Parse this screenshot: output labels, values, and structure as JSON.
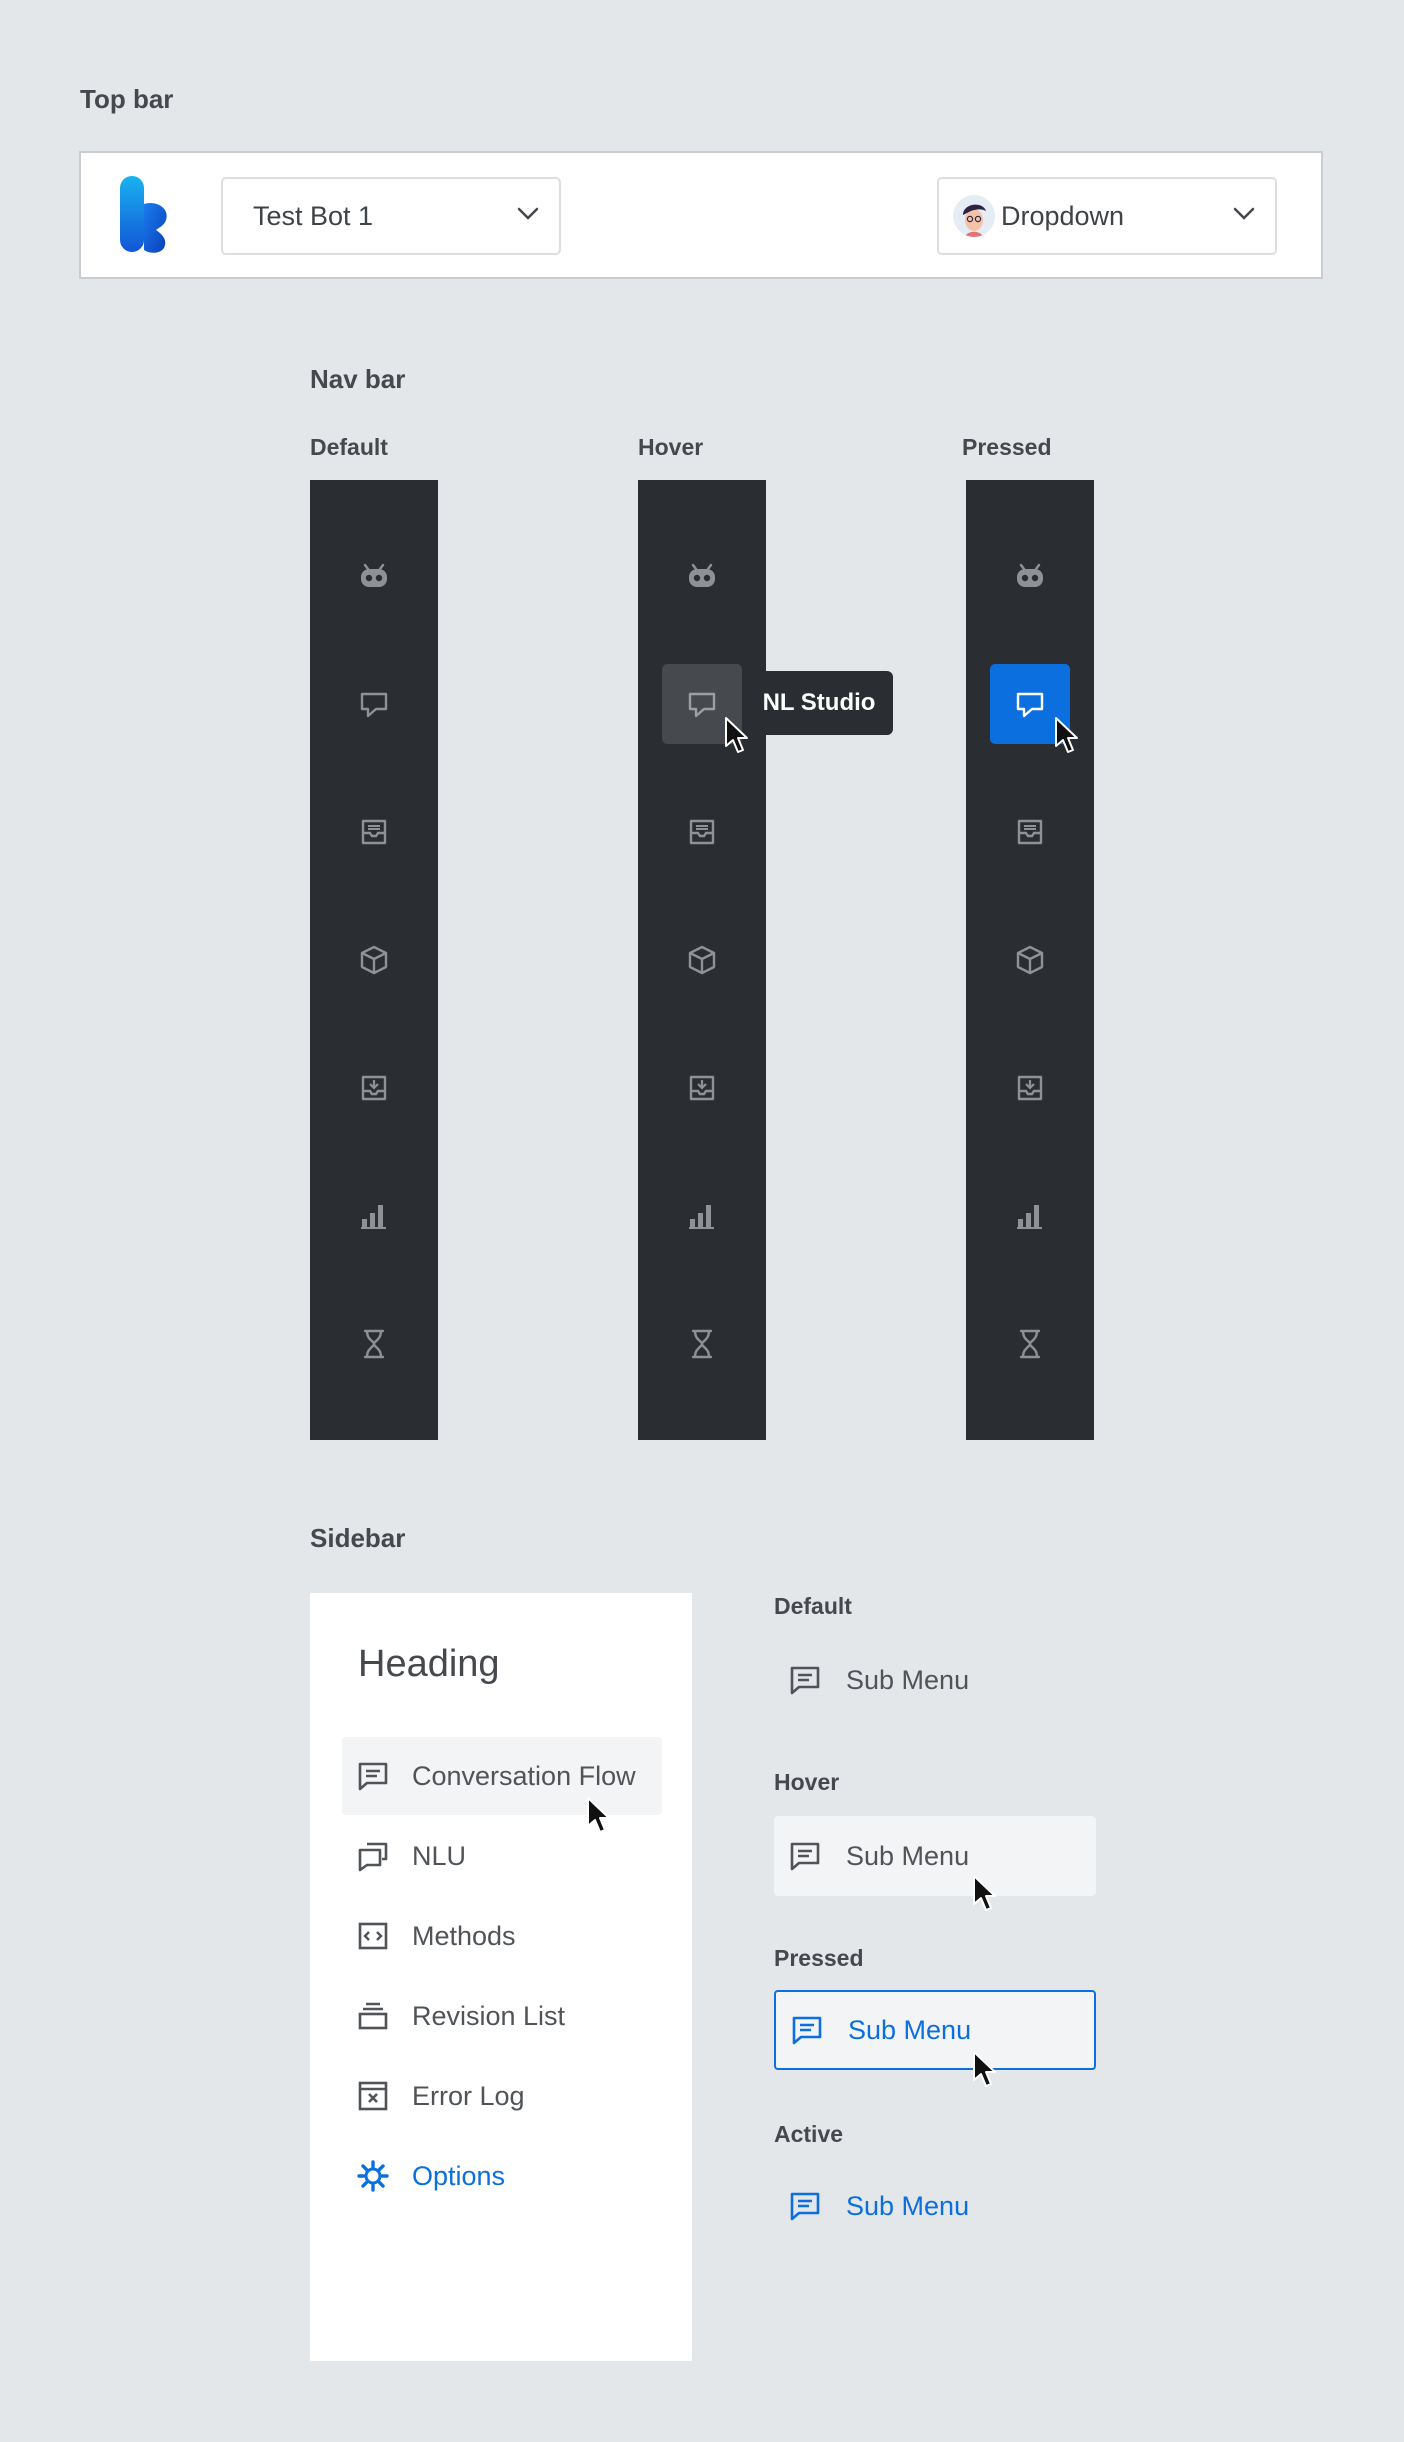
{
  "sections": {
    "topbar": "Top bar",
    "navbar": "Nav bar",
    "sidebar": "Sidebar"
  },
  "topbar": {
    "bot_select_value": "Test Bot 1",
    "user_select_value": "Dropdown"
  },
  "navbar": {
    "states": [
      "Default",
      "Hover",
      "Pressed"
    ],
    "tooltip": "NL Studio",
    "icons": [
      "robot-icon",
      "chat-bubble-icon",
      "inbox-icon",
      "cube-icon",
      "download-tray-icon",
      "bar-chart-icon",
      "hourglass-icon"
    ]
  },
  "sidebar": {
    "heading": "Heading",
    "items": [
      {
        "label": "Conversation Flow",
        "icon": "message-square-icon",
        "state": "hover"
      },
      {
        "label": "NLU",
        "icon": "messages-icon",
        "state": "default"
      },
      {
        "label": "Methods",
        "icon": "code-icon",
        "state": "default"
      },
      {
        "label": "Revision List",
        "icon": "layers-icon",
        "state": "default"
      },
      {
        "label": "Error Log",
        "icon": "error-window-icon",
        "state": "default"
      },
      {
        "label": "Options",
        "icon": "gear-icon",
        "state": "active"
      }
    ]
  },
  "submenu_states": {
    "default_label": "Default",
    "hover_label": "Hover",
    "pressed_label": "Pressed",
    "active_label": "Active",
    "item_label": "Sub Menu"
  },
  "colors": {
    "accent": "#0b6fe0",
    "nav_bg": "#2a2d31",
    "page_bg": "#e4e7ea"
  }
}
